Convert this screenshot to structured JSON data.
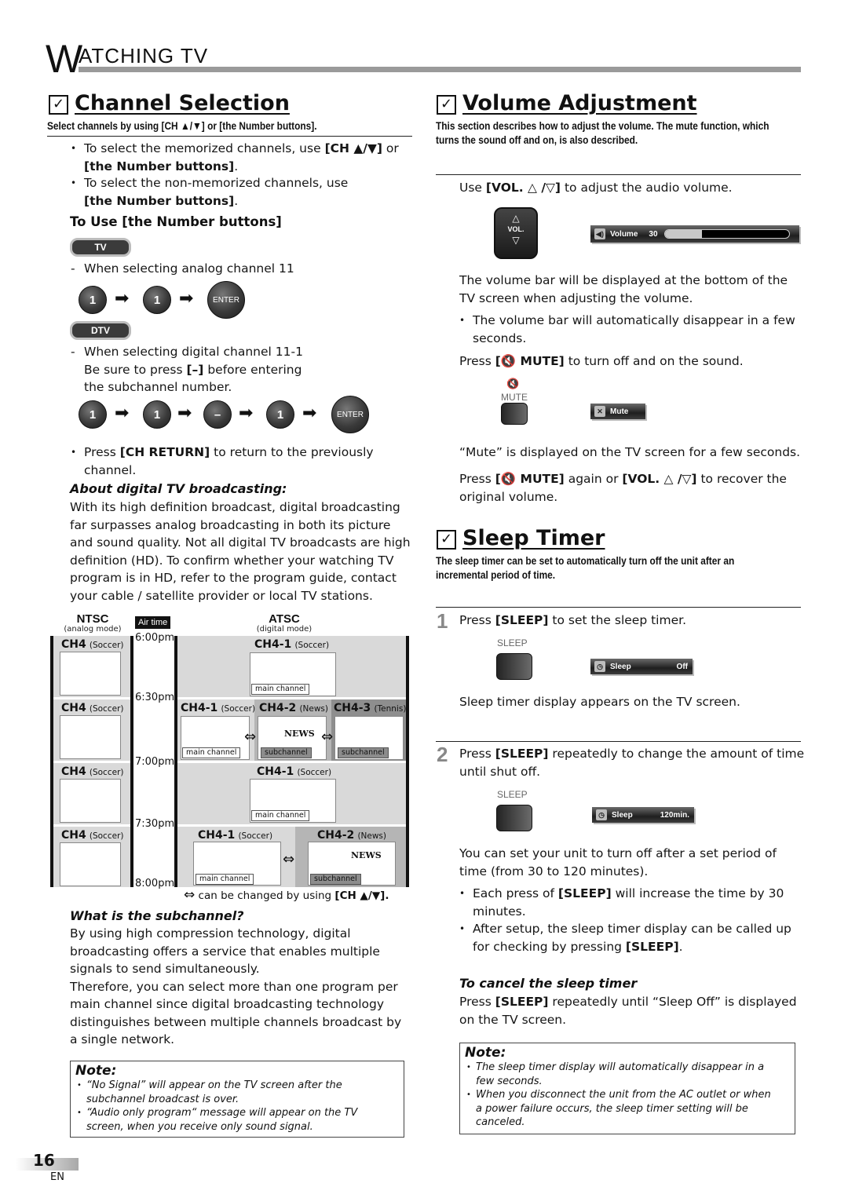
{
  "header": {
    "initial": "W",
    "rest": "ATCHING  TV"
  },
  "channel_selection": {
    "title": "Channel Selection",
    "subtitle": "Select channels by using [CH ▲/▼] or [the Number buttons].",
    "bullets": [
      {
        "pre": "To select the memorized channels, use ",
        "bold": "[CH ▲/▼]",
        "post": " or",
        "line2_bold": "[the Number buttons]",
        "line2_post": "."
      },
      {
        "pre": "To select the non-memorized channels, use",
        "line2_bold": "[the Number buttons]",
        "line2_post": "."
      }
    ],
    "number_heading": "To Use [the Number buttons]",
    "tv_pill": "TV",
    "analog_caption": "When selecting analog channel 11",
    "analog_sequence": [
      "1",
      "1",
      "ENTER"
    ],
    "dtv_pill": "DTV",
    "digital_caption_1": "When selecting digital channel 11-1",
    "digital_caption_2_pre": "Be sure to press ",
    "digital_caption_2_bold": "[–]",
    "digital_caption_2_post": " before entering",
    "digital_caption_3": "the subchannel number.",
    "digital_sequence": [
      "1",
      "1",
      "–",
      "1",
      "ENTER"
    ],
    "return_pre": "Press ",
    "return_bold": "[CH RETURN]",
    "return_post": " to return to the previously",
    "return_line2": "channel.",
    "about_heading": "About digital TV broadcasting:",
    "about_lines": [
      "With its high definition broadcast, digital broadcasting",
      "far surpasses analog broadcasting in both its picture",
      "and sound quality. Not all digital TV broadcasts are high",
      "definition (HD). To confirm whether your watching TV",
      "program is in HD, refer to the program guide, contact",
      "your cable / satellite provider or local TV stations."
    ],
    "diagram": {
      "ntsc": "NTSC",
      "ntsc_sub": "(analog mode)",
      "airtime": "Air time",
      "atsc": "ATSC",
      "atsc_sub": "(digital mode)",
      "times": [
        "6:00pm",
        "6:30pm",
        "7:00pm",
        "7:30pm",
        "8:00pm"
      ],
      "analog_rows": [
        {
          "ch": "CH4",
          "prog": "(Soccer)"
        },
        {
          "ch": "CH4",
          "prog": "(Soccer)"
        },
        {
          "ch": "CH4",
          "prog": "(Soccer)"
        },
        {
          "ch": "CH4",
          "prog": "(Soccer)"
        }
      ],
      "digital_rows": [
        [
          {
            "ch": "CH4-1",
            "prog": "(Soccer)",
            "tag": "main channel"
          }
        ],
        [
          {
            "ch": "CH4-1",
            "prog": "(Soccer)",
            "tag": "main channel"
          },
          {
            "ch": "CH4-2",
            "prog": "(News)",
            "tag": "subchannel"
          },
          {
            "ch": "CH4-3",
            "prog": "(Tennis)",
            "tag": "subchannel"
          }
        ],
        [
          {
            "ch": "CH4-1",
            "prog": "(Soccer)",
            "tag": "main channel"
          }
        ],
        [
          {
            "ch": "CH4-1",
            "prog": "(Soccer)",
            "tag": "main channel"
          },
          {
            "ch": "CH4-2",
            "prog": "(News)",
            "tag": "subchannel"
          }
        ]
      ],
      "news_label": "NEWS",
      "legend_pre": "can be changed by using ",
      "legend_bold": "[CH ▲/▼]."
    },
    "subchannel_heading": "What is the subchannel?",
    "subchannel_lines": [
      "By using high compression technology, digital",
      "broadcasting offers a service that enables multiple",
      "signals to send simultaneously.",
      "Therefore, you can select more than one program per",
      "main channel since digital broadcasting technology",
      "distinguishes between multiple channels broadcast by",
      "a single network."
    ],
    "note": {
      "heading": "Note:",
      "items": [
        [
          "“No Signal” will appear on the TV screen after the",
          "subchannel broadcast is over."
        ],
        [
          "“Audio only program“ message will appear on the TV",
          "screen, when you receive only sound signal."
        ]
      ]
    }
  },
  "volume": {
    "title": "Volume Adjustment",
    "subtitle_1": "This section describes how to adjust the volume. The mute function, which",
    "subtitle_2": "turns the sound off and on, is also described.",
    "use_pre": "Use ",
    "use_bold": "[VOL. △ /▽]",
    "use_post": " to adjust the audio volume.",
    "vol_button": {
      "up": "△",
      "label": "VOL.",
      "down": "▽"
    },
    "osd": {
      "label": "Volume",
      "value": "30",
      "level_percent": 30
    },
    "bar_text_1": "The volume bar will be displayed at the bottom of the",
    "bar_text_2": "TV screen when adjusting the volume.",
    "bar_bullet_1": "The volume bar will automatically disappear in a few",
    "bar_bullet_2": "seconds.",
    "mute_pre": "Press ",
    "mute_bold": "[🔇 MUTE]",
    "mute_post": " to turn off and on the sound.",
    "mute_button_label": "MUTE",
    "mute_osd": "Mute",
    "mute_shown": "“Mute” is displayed on the TV screen for a few seconds.",
    "recover_pre": "Press ",
    "recover_bold1": "[🔇 MUTE]",
    "recover_mid": " again or ",
    "recover_bold2": "[VOL. △ /▽]",
    "recover_post": " to recover the",
    "recover_line2": "original volume."
  },
  "sleep": {
    "title": "Sleep Timer",
    "subtitle_1": "The sleep timer can be set to automatically turn off the unit after an",
    "subtitle_2": "incremental period of time.",
    "step1": {
      "num": "1",
      "pre": "Press ",
      "bold": "[SLEEP]",
      "post": " to set the sleep timer."
    },
    "button_label": "SLEEP",
    "osd1": {
      "label": "Sleep",
      "value": "Off"
    },
    "step1_after": "Sleep timer display appears on the TV screen.",
    "step2": {
      "num": "2",
      "pre": "Press ",
      "bold": "[SLEEP]",
      "post": " repeatedly to change the amount of time",
      "line2": "until shut off."
    },
    "osd2": {
      "label": "Sleep",
      "value": "120min."
    },
    "step2_after_1": "You can set your unit to turn off after a set period of",
    "step2_after_2": "time (from 30 to 120 minutes).",
    "bullet1_pre": "Each press of ",
    "bullet1_bold": "[SLEEP]",
    "bullet1_post": " will increase the time by 30",
    "bullet1_line2": "minutes.",
    "bullet2_line1": "After setup, the sleep timer display can be called up",
    "bullet2_pre": "for checking by pressing ",
    "bullet2_bold": "[SLEEP]",
    "bullet2_post": ".",
    "cancel_heading": "To cancel the sleep timer",
    "cancel_pre": "Press ",
    "cancel_bold": "[SLEEP]",
    "cancel_post": " repeatedly until “Sleep Off” is displayed",
    "cancel_line2": "on the TV screen.",
    "note": {
      "heading": "Note:",
      "items": [
        [
          "The sleep timer display will automatically disappear in a",
          "few seconds."
        ],
        [
          "When you disconnect the unit from the AC outlet or when",
          "a power failure occurs, the sleep timer setting will be",
          "canceled."
        ]
      ]
    }
  },
  "footer": {
    "page": "16",
    "lang": "EN"
  }
}
